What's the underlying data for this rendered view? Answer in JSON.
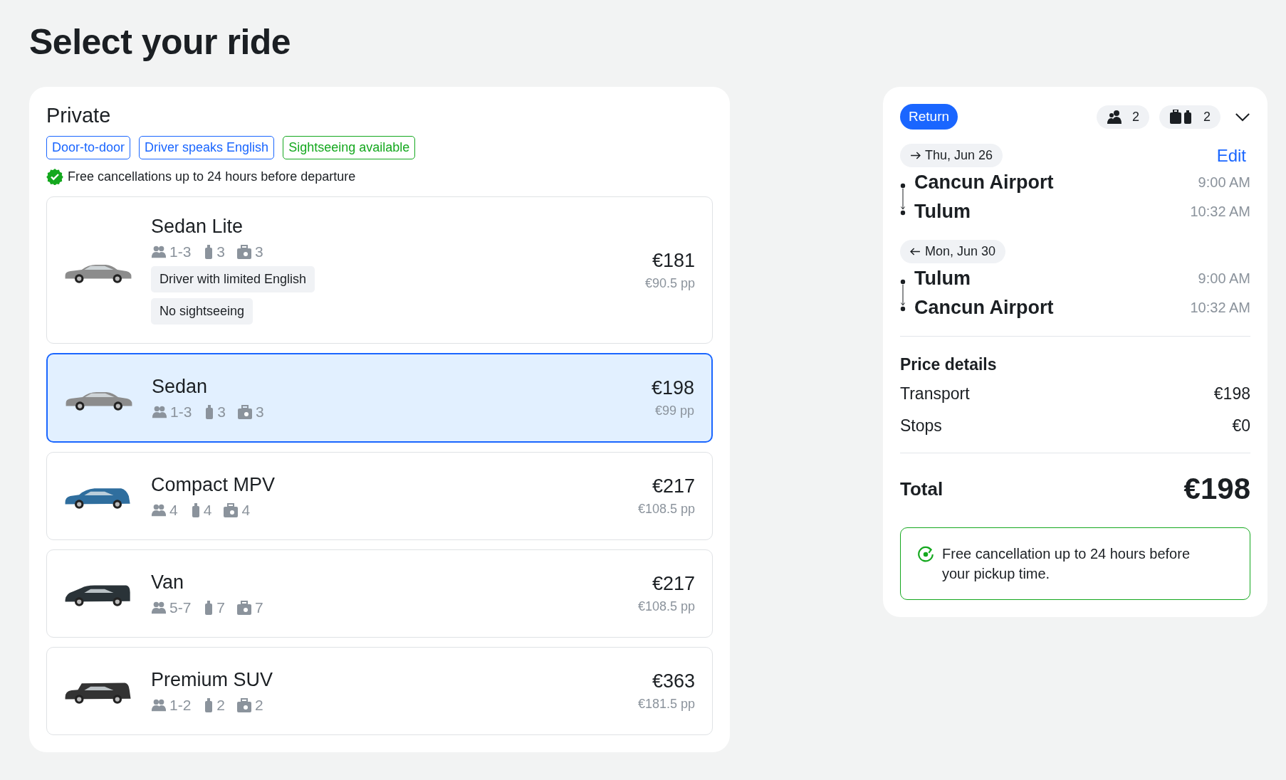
{
  "page_title": "Select your ride",
  "private": {
    "title": "Private",
    "tags": [
      {
        "label": "Door-to-door",
        "color": "#1a66ff"
      },
      {
        "label": "Driver speaks English",
        "color": "#1a66ff"
      },
      {
        "label": "Sightseeing available",
        "color": "#14a81e"
      }
    ],
    "notice": "Free cancellations up to 24 hours before departure",
    "vehicles": [
      {
        "name": "Sedan Lite",
        "kind": "sedan",
        "color": "#8c8c8c",
        "passengers": "1-3",
        "bags": "3",
        "luggage": "3",
        "extras": [
          "Driver with limited English",
          "No sightseeing"
        ],
        "price": "€181",
        "per_person": "€90.5 pp",
        "selected": false
      },
      {
        "name": "Sedan",
        "kind": "sedan",
        "color": "#8c8c8c",
        "passengers": "1-3",
        "bags": "3",
        "luggage": "3",
        "price": "€198",
        "per_person": "€99 pp",
        "selected": true
      },
      {
        "name": "Compact MPV",
        "kind": "mpv",
        "color": "#2f6e9e",
        "passengers": "4",
        "bags": "4",
        "luggage": "4",
        "price": "€217",
        "per_person": "€108.5 pp",
        "selected": false
      },
      {
        "name": "Van",
        "kind": "van",
        "color": "#2a3338",
        "passengers": "5-7",
        "bags": "7",
        "luggage": "7",
        "price": "€217",
        "per_person": "€108.5 pp",
        "selected": false
      },
      {
        "name": "Premium SUV",
        "kind": "suv",
        "color": "#333333",
        "passengers": "1-2",
        "bags": "2",
        "luggage": "2",
        "price": "€363",
        "per_person": "€181.5 pp",
        "selected": false
      }
    ]
  },
  "summary": {
    "trip_type": "Return",
    "passengers": "2",
    "luggage": "2",
    "edit": "Edit",
    "legs": [
      {
        "kind": "outbound",
        "date": "Thu, Jun 26",
        "stops": [
          {
            "place": "Cancun Airport",
            "time": "9:00 AM"
          },
          {
            "place": "Tulum",
            "time": "10:32 AM"
          }
        ]
      },
      {
        "kind": "return",
        "date": "Mon, Jun 30",
        "stops": [
          {
            "place": "Tulum",
            "time": "9:00 AM"
          },
          {
            "place": "Cancun Airport",
            "time": "10:32 AM"
          }
        ]
      }
    ],
    "price_details": {
      "title": "Price details",
      "lines": [
        {
          "label": "Transport",
          "value": "€198"
        },
        {
          "label": "Stops",
          "value": "€0"
        }
      ]
    },
    "total": {
      "label": "Total",
      "value": "€198"
    },
    "cancellation": "Free cancellation up to 24 hours before your pickup time."
  }
}
